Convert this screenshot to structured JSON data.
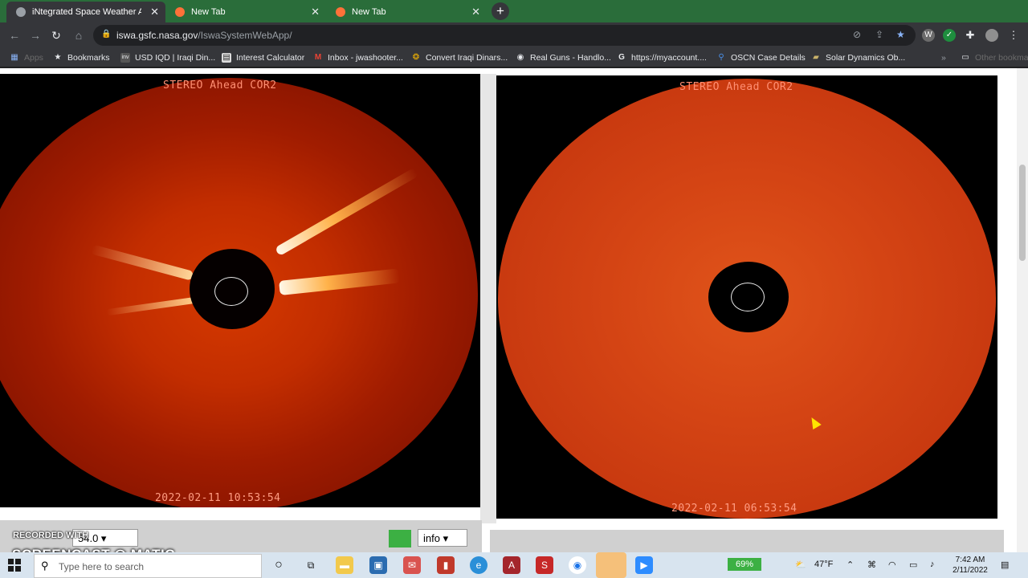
{
  "browser": {
    "tabs": [
      {
        "title": "iNtegrated Space Weather Analy",
        "active": true
      },
      {
        "title": "New Tab",
        "active": false
      },
      {
        "title": "New Tab",
        "active": false
      }
    ],
    "new_tab_label": "+",
    "url_host": "iswa.gsfc.nasa.gov",
    "url_path": "/IswaSystemWebApp/",
    "bookmarks": [
      {
        "label": "Apps",
        "icon": "apps-grid-icon"
      },
      {
        "label": "Bookmarks",
        "icon": "star-icon"
      },
      {
        "label": "USD IQD | Iraqi Din...",
        "icon": "inv-icon"
      },
      {
        "label": "Interest Calculator",
        "icon": "calculator-icon"
      },
      {
        "label": "Inbox - jwashooter...",
        "icon": "gmail-icon"
      },
      {
        "label": "Convert Iraqi Dinars...",
        "icon": "convert-icon"
      },
      {
        "label": "Real Guns - Handlo...",
        "icon": "globe-icon"
      },
      {
        "label": "https://myaccount....",
        "icon": "google-icon"
      },
      {
        "label": "OSCN Case Details",
        "icon": "oscn-icon"
      },
      {
        "label": "Solar Dynamics Ob...",
        "icon": "sdo-icon"
      }
    ],
    "other_bookmarks_label": "Other bookmarks"
  },
  "panels": [
    {
      "title": "STEREO Ahead COR2",
      "timestamp": "2022-02-11  10:53:54"
    },
    {
      "title": "STEREO Ahead COR2",
      "timestamp": "2022-02-11  06:53:54"
    }
  ],
  "controls": {
    "left_select_value": "54.0",
    "info_select_value": "info"
  },
  "overlay": {
    "recorded_with": "RECORDED WITH",
    "brand": "SCREENCAST",
    "brand_suffix": "MATIC"
  },
  "taskbar": {
    "search_placeholder": "Type here to search",
    "battery": "69%",
    "temperature": "47°F",
    "time": "7:42 AM",
    "date": "2/11/2022"
  },
  "colors": {
    "tab_strip": "#2a6d3a",
    "chrome_toolbar": "#35363a",
    "corona_left": "#b02200",
    "corona_right": "#d03a10"
  }
}
